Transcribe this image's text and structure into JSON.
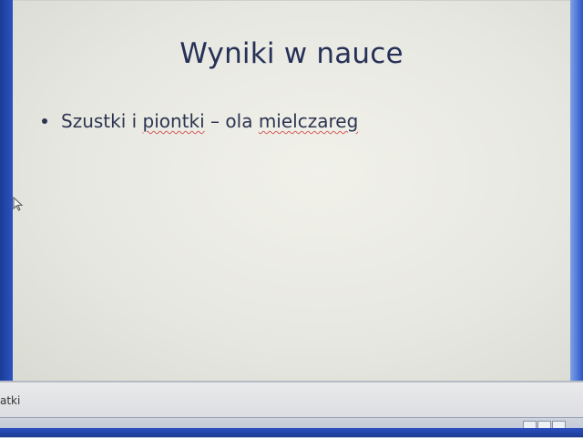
{
  "slide": {
    "title": "Wyniki w nauce",
    "bullets": [
      {
        "parts": [
          "Szustki i ",
          "piontki",
          " – ola ",
          "mielczareg"
        ]
      }
    ]
  },
  "notes": {
    "text": "atki"
  },
  "colors": {
    "frame": "#1f3f9a",
    "slide_bg": "#e9eae3",
    "title_text": "#273057",
    "spellcheck": "#d55b5b"
  },
  "icons": [
    "cursor-arrow-icon",
    "normal-view-icon",
    "slide-sorter-icon",
    "slideshow-icon"
  ]
}
